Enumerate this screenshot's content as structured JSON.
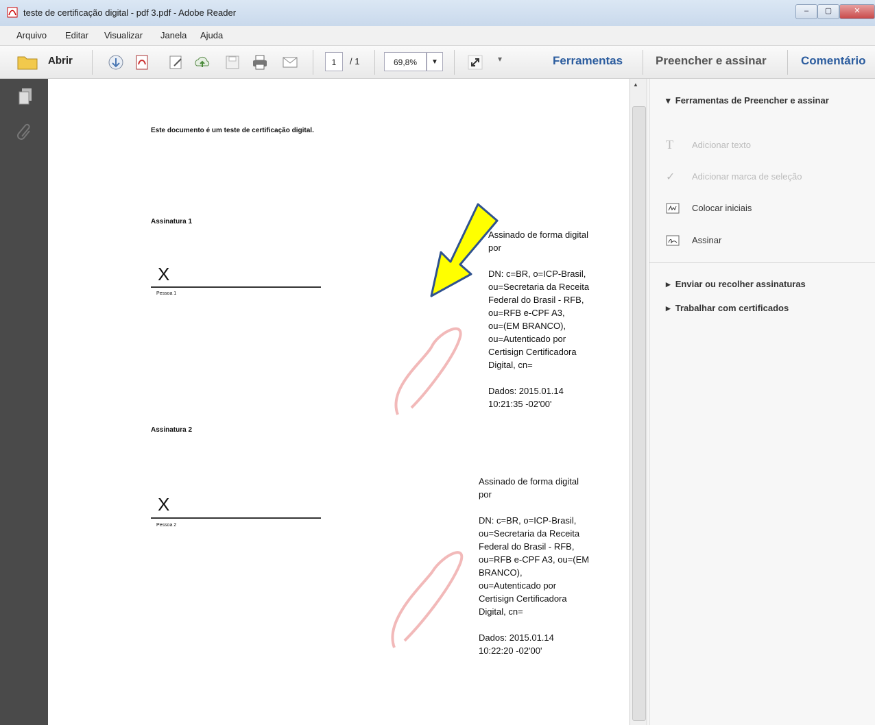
{
  "window": {
    "title": "teste de certificação digital - pdf 3.pdf - Adobe Reader"
  },
  "menu": [
    "Arquivo",
    "Editar",
    "Visualizar",
    "Janela",
    "Ajuda"
  ],
  "toolbar": {
    "open_label": "Abrir",
    "page_current": "1",
    "page_total": "/ 1",
    "zoom": "69,8%",
    "tools_label": "Ferramentas",
    "fill_sign_label": "Preencher e assinar",
    "comment_label": "Comentário"
  },
  "right_panel": {
    "section_title": "Ferramentas de Preencher e assinar",
    "items": [
      {
        "label": "Adicionar texto",
        "icon": "text-icon",
        "enabled": false
      },
      {
        "label": "Adicionar marca de seleção",
        "icon": "checkmark-icon",
        "enabled": false
      },
      {
        "label": "Colocar iniciais",
        "icon": "initials-icon",
        "enabled": true
      },
      {
        "label": "Assinar",
        "icon": "sign-icon",
        "enabled": true
      }
    ],
    "collapsed_sections": [
      "Enviar ou recolher assinaturas",
      "Trabalhar com certificados"
    ]
  },
  "document": {
    "intro": "Este documento é um teste de certificação digital.",
    "signature1": {
      "heading": "Assinatura 1",
      "mark": "X",
      "person": "Pessoa 1",
      "block": "Assinado de forma digital\npor\n\nDN: c=BR, o=ICP-Brasil,\nou=Secretaria da Receita\nFederal do Brasil - RFB,\nou=RFB e-CPF A3,\nou=(EM BRANCO),\nou=Autenticado por\nCertisign Certificadora\nDigital, cn=\n\nDados: 2015.01.14\n10:21:35 -02'00'"
    },
    "signature2": {
      "heading": "Assinatura 2",
      "mark": "X",
      "person": "Pessoa 2",
      "block": "Assinado de forma digital\npor\n\nDN: c=BR, o=ICP-Brasil,\nou=Secretaria da Receita\nFederal do Brasil - RFB,\nou=RFB e-CPF A3, ou=(EM\nBRANCO),\nou=Autenticado por\nCertisign Certificadora\nDigital, cn=\n\nDados: 2015.01.14\n10:22:20 -02'00'"
    },
    "arrow_color": "#ffff00"
  }
}
